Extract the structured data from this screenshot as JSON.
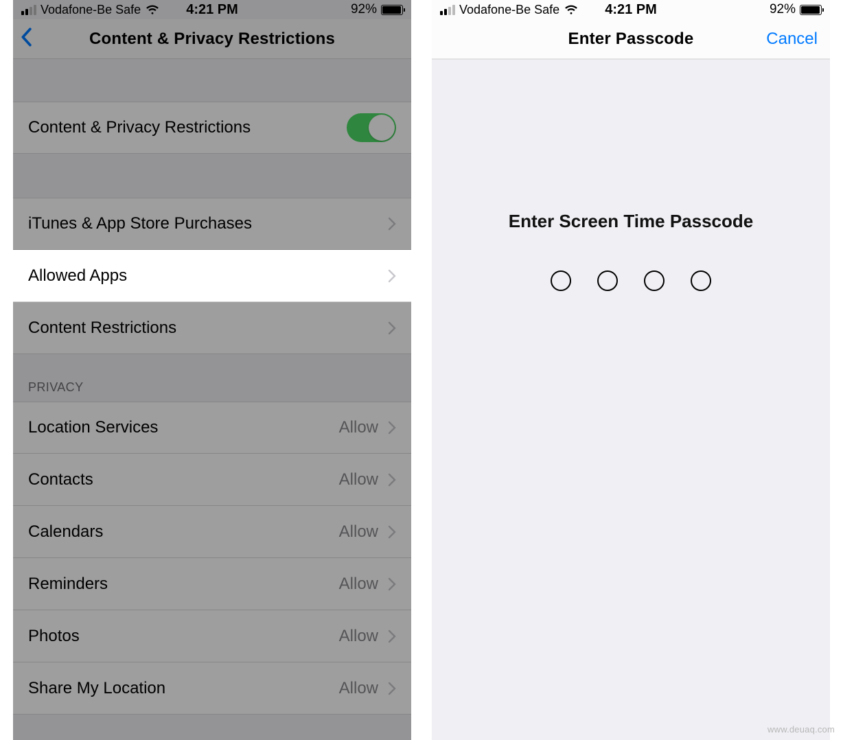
{
  "status": {
    "carrier": "Vodafone-Be Safe",
    "time": "4:21 PM",
    "battery": "92%"
  },
  "left": {
    "title": "Content & Privacy Restrictions",
    "toggle_label": "Content & Privacy Restrictions",
    "rows": {
      "itunes": "iTunes & App Store Purchases",
      "allowed": "Allowed Apps",
      "content": "Content Restrictions"
    },
    "privacy_header": "PRIVACY",
    "privacy_rows": [
      {
        "label": "Location Services",
        "value": "Allow"
      },
      {
        "label": "Contacts",
        "value": "Allow"
      },
      {
        "label": "Calendars",
        "value": "Allow"
      },
      {
        "label": "Reminders",
        "value": "Allow"
      },
      {
        "label": "Photos",
        "value": "Allow"
      },
      {
        "label": "Share My Location",
        "value": "Allow"
      }
    ]
  },
  "right": {
    "title": "Enter Passcode",
    "cancel": "Cancel",
    "prompt": "Enter Screen Time Passcode"
  },
  "watermark": "www.deuaq.com"
}
